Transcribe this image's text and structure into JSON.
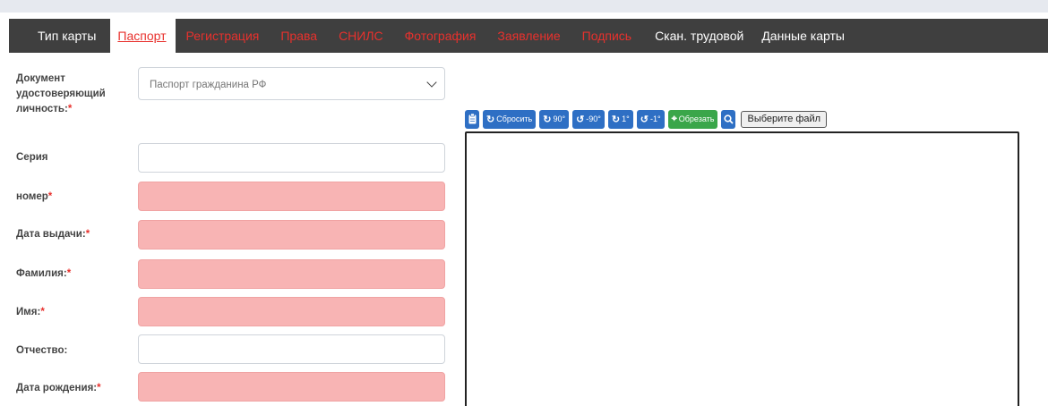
{
  "tabs": [
    {
      "label": "Тип карты",
      "state": "plain"
    },
    {
      "label": "Паспорт",
      "state": "active"
    },
    {
      "label": "Регистрация",
      "state": "red"
    },
    {
      "label": "Права",
      "state": "red"
    },
    {
      "label": "СНИЛС",
      "state": "red"
    },
    {
      "label": "Фотография",
      "state": "red"
    },
    {
      "label": "Заявление",
      "state": "red"
    },
    {
      "label": "Подпись",
      "state": "red"
    },
    {
      "label": "Скан. трудовой",
      "state": "plain"
    },
    {
      "label": "Данные карты",
      "state": "plain"
    }
  ],
  "form": {
    "doc_label_1": "Документ",
    "doc_label_2": "удостоверяющий",
    "doc_label_3": "личность:",
    "doc_select_value": "Паспорт гражданина РФ",
    "required_mark": "*",
    "series_label": "Серия",
    "number_label": "номер",
    "issue_date_label": "Дата выдачи:",
    "surname_label": "Фамилия:",
    "name_label": "Имя:",
    "patronymic_label": "Отчество:",
    "birth_date_label": "Дата рождения:"
  },
  "toolbar": {
    "reset": "Сбросить",
    "rotate_right_90": "90°",
    "rotate_left_90": "-90°",
    "rotate_right_1": "1°",
    "rotate_left_1": "-1°",
    "crop": "Обрезать",
    "choose_file": "Выберите файл"
  },
  "colors": {
    "tabbar_bg": "#3f3f3f",
    "tab_red": "#e8312d",
    "invalid_field": "#f8b4b4",
    "button_blue": "#2e6fc4",
    "button_green": "#3aa64a"
  }
}
